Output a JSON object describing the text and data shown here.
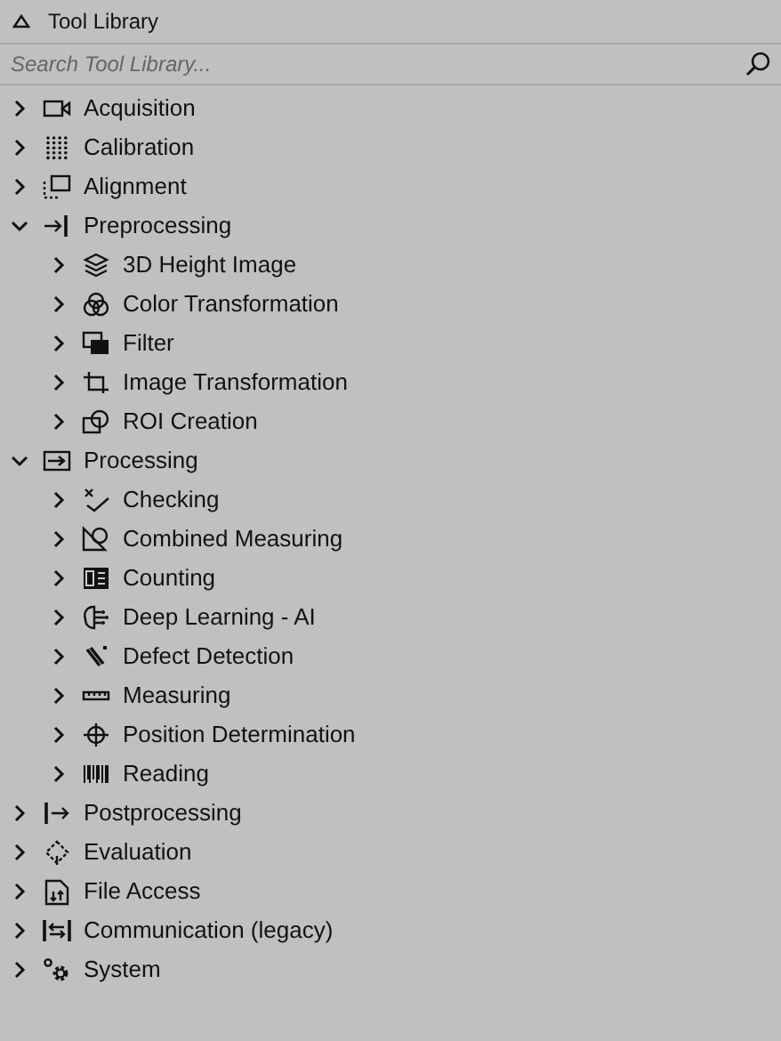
{
  "panel": {
    "title": "Tool Library",
    "expanded": true
  },
  "search": {
    "placeholder": "Search Tool Library..."
  },
  "tree": [
    {
      "label": "Acquisition",
      "expanded": false
    },
    {
      "label": "Calibration",
      "expanded": false
    },
    {
      "label": "Alignment",
      "expanded": false
    },
    {
      "label": "Preprocessing",
      "expanded": true,
      "children": [
        {
          "label": "3D Height Image",
          "expanded": false
        },
        {
          "label": "Color Transformation",
          "expanded": false
        },
        {
          "label": "Filter",
          "expanded": false
        },
        {
          "label": "Image Transformation",
          "expanded": false
        },
        {
          "label": "ROI Creation",
          "expanded": false
        }
      ]
    },
    {
      "label": "Processing",
      "expanded": true,
      "children": [
        {
          "label": "Checking",
          "expanded": false
        },
        {
          "label": "Combined Measuring",
          "expanded": false
        },
        {
          "label": "Counting",
          "expanded": false
        },
        {
          "label": "Deep Learning - AI",
          "expanded": false
        },
        {
          "label": "Defect Detection",
          "expanded": false
        },
        {
          "label": "Measuring",
          "expanded": false
        },
        {
          "label": "Position Determination",
          "expanded": false
        },
        {
          "label": "Reading",
          "expanded": false
        }
      ]
    },
    {
      "label": "Postprocessing",
      "expanded": false
    },
    {
      "label": "Evaluation",
      "expanded": false
    },
    {
      "label": "File Access",
      "expanded": false
    },
    {
      "label": "Communication (legacy)",
      "expanded": false
    },
    {
      "label": "System",
      "expanded": false
    }
  ]
}
